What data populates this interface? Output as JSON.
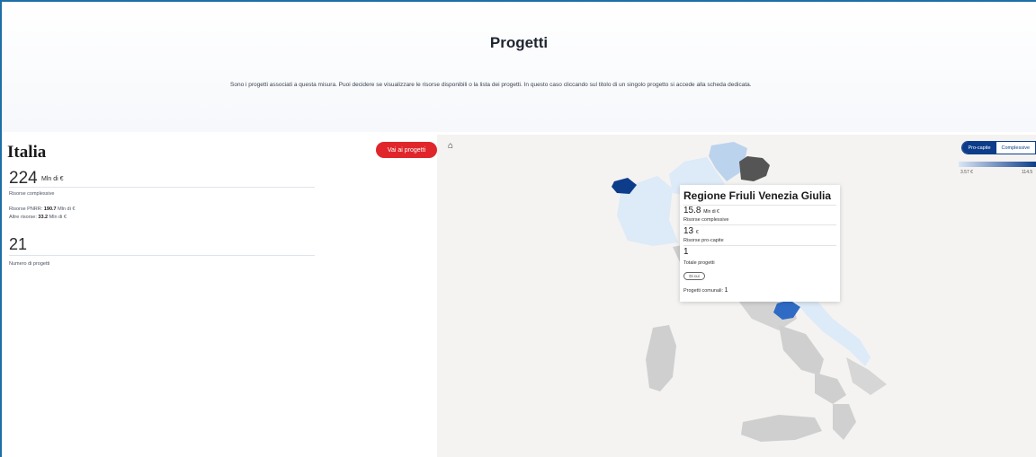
{
  "header": {
    "title": "Progetti",
    "intro": "Sono i progetti associati a questa misura. Puoi decidere se visualizzare le risorse disponibili o la lista dei progetti. In questo caso cliccando sul titolo di un singolo progetto si accede alla scheda dedicata."
  },
  "summary": {
    "region": "Italia",
    "cta_label": "Vai ai progetti",
    "total_value": "224",
    "total_unit": "Mln di €",
    "total_label": "Risorse complessive",
    "pnrr_label": "Risorse PNRR:",
    "pnrr_value": "190.7",
    "pnrr_unit": "Mln di €",
    "other_label": "Altre risorse:",
    "other_value": "33.2",
    "other_unit": "Mln di €",
    "projects_value": "21",
    "projects_label": "Numero di progetti"
  },
  "map": {
    "home_icon": "home-icon",
    "toggle": {
      "on": "Pro-capite",
      "off": "Complessive"
    },
    "legend": {
      "min": "3.57 €",
      "max": "114.5"
    },
    "colors": {
      "dark_blue": "#0d3d8a",
      "mid_blue": "#2f6bc5",
      "light_blue": "#bcd3ee",
      "pale_blue": "#ddeaf7",
      "selected_gray": "#555555",
      "no_data_gray": "#cfcfcf"
    },
    "tooltip": {
      "title": "Regione Friuli Venezia Giulia",
      "resources_value": "15.8",
      "resources_unit": "Mln di €",
      "resources_label": "Risorse complessive",
      "percapita_value": "13",
      "percapita_unit": "€",
      "percapita_label": "Risorse pro-capite",
      "projects_value": "1",
      "projects_label": "Totale progetti",
      "of_which_label": "Di cui",
      "municipal_label": "Progetti comunali:",
      "municipal_value": "1"
    }
  }
}
